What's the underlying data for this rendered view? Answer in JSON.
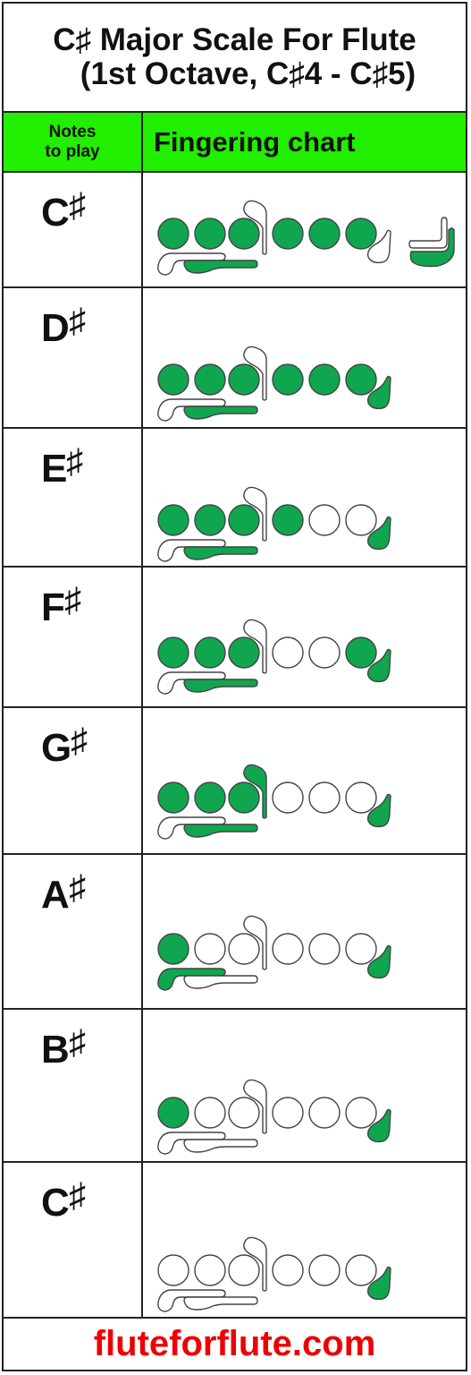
{
  "title": {
    "line1": "C♯ Major Scale For Flute",
    "line2": "(1st Octave, C♯4 - C♯5)"
  },
  "header": {
    "notes_col": "Notes to play",
    "notes_col_line1": "Notes",
    "notes_col_line2": "to play",
    "chart_col": "Fingering chart"
  },
  "colors": {
    "closed": "#10a650",
    "open": "#ffffff",
    "outline": "#444444",
    "header_bg": "#22ee00",
    "footer_text": "#ee0000"
  },
  "notes": [
    {
      "letter": "C",
      "accidental": "♯",
      "keys": {
        "thumb_b": false,
        "thumb_bb": true,
        "h1": true,
        "h2": true,
        "h3": true,
        "gsharp": false,
        "h4": true,
        "h5": true,
        "h6": true,
        "eb": false,
        "csharp_foot": false,
        "c_foot": true,
        "has_foot": true
      }
    },
    {
      "letter": "D",
      "accidental": "♯",
      "keys": {
        "thumb_b": false,
        "thumb_bb": true,
        "h1": true,
        "h2": true,
        "h3": true,
        "gsharp": false,
        "h4": true,
        "h5": true,
        "h6": true,
        "eb": true,
        "has_foot": false
      }
    },
    {
      "letter": "E",
      "accidental": "♯",
      "keys": {
        "thumb_b": false,
        "thumb_bb": true,
        "h1": true,
        "h2": true,
        "h3": true,
        "gsharp": false,
        "h4": true,
        "h5": false,
        "h6": false,
        "eb": true,
        "has_foot": false
      }
    },
    {
      "letter": "F",
      "accidental": "♯",
      "keys": {
        "thumb_b": false,
        "thumb_bb": true,
        "h1": true,
        "h2": true,
        "h3": true,
        "gsharp": false,
        "h4": false,
        "h5": false,
        "h6": true,
        "eb": true,
        "has_foot": false
      }
    },
    {
      "letter": "G",
      "accidental": "♯",
      "keys": {
        "thumb_b": false,
        "thumb_bb": true,
        "h1": true,
        "h2": true,
        "h3": true,
        "gsharp": true,
        "h4": false,
        "h5": false,
        "h6": false,
        "eb": true,
        "has_foot": false
      }
    },
    {
      "letter": "A",
      "accidental": "♯",
      "keys": {
        "thumb_b": true,
        "thumb_bb": false,
        "h1": true,
        "h2": false,
        "h3": false,
        "gsharp": false,
        "h4": false,
        "h5": false,
        "h6": false,
        "eb": true,
        "has_foot": false
      }
    },
    {
      "letter": "B",
      "accidental": "♯",
      "keys": {
        "thumb_b": false,
        "thumb_bb": false,
        "h1": true,
        "h2": false,
        "h3": false,
        "gsharp": false,
        "h4": false,
        "h5": false,
        "h6": false,
        "eb": true,
        "has_foot": false
      }
    },
    {
      "letter": "C",
      "accidental": "♯",
      "keys": {
        "thumb_b": false,
        "thumb_bb": false,
        "h1": false,
        "h2": false,
        "h3": false,
        "gsharp": false,
        "h4": false,
        "h5": false,
        "h6": false,
        "eb": true,
        "has_foot": false
      }
    }
  ],
  "footer": {
    "site": "fluteforflute.com"
  }
}
